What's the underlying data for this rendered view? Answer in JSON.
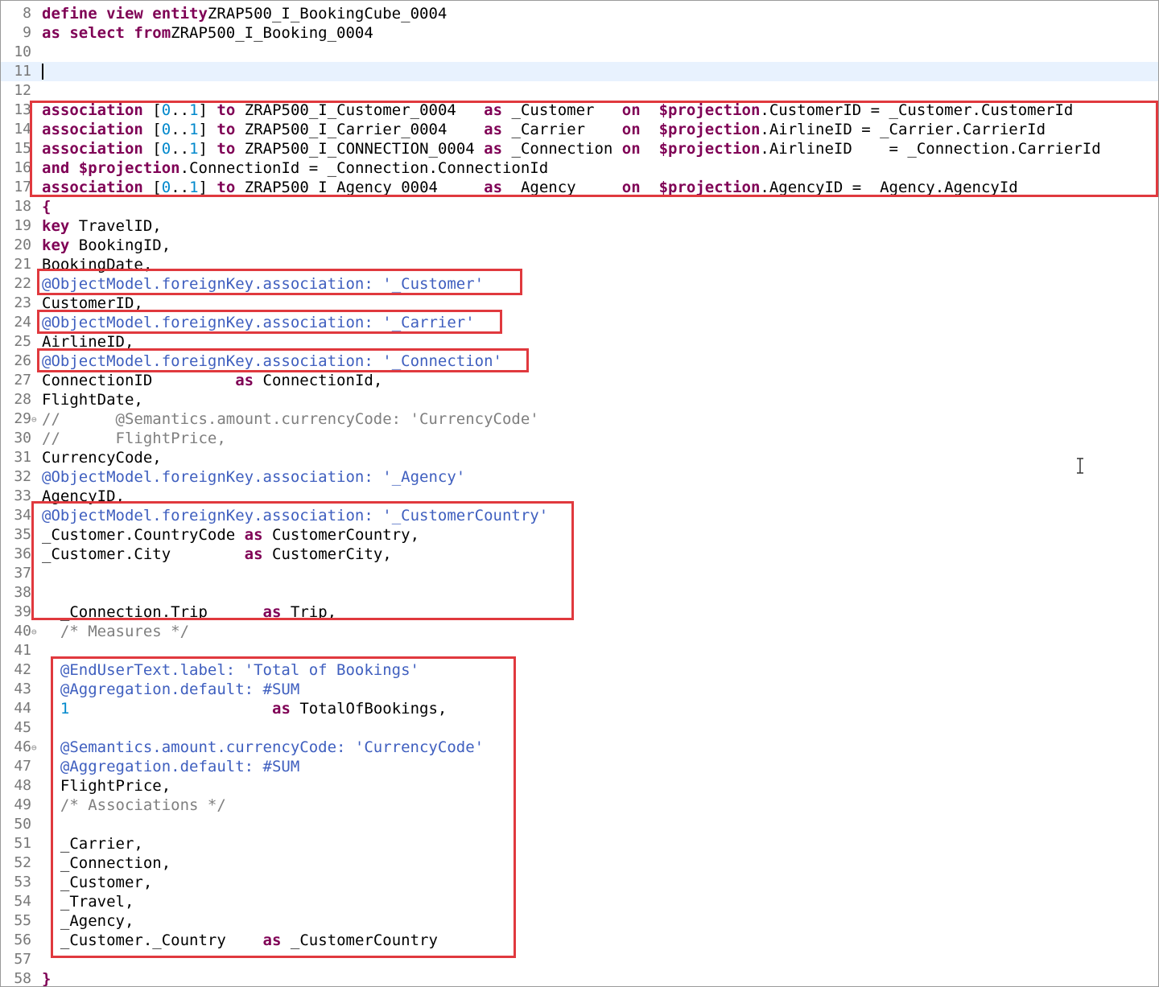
{
  "editor": {
    "current_line": "11",
    "lines": [
      {
        "n": "8",
        "fold": "",
        "segs": [
          [
            "kw",
            "define view entity"
          ],
          [
            "",
            "ZRAP500_I_BookingCube_0004"
          ]
        ]
      },
      {
        "n": "9",
        "fold": "",
        "segs": [
          [
            "kw",
            "as select from"
          ],
          [
            "",
            "ZRAP500_I_Booking_0004"
          ]
        ]
      },
      {
        "n": "10",
        "fold": "",
        "segs": []
      },
      {
        "n": "11",
        "fold": "",
        "segs": []
      },
      {
        "n": "12",
        "fold": "",
        "segs": []
      },
      {
        "n": "13",
        "fold": "",
        "segs": [
          [
            "kw",
            "association"
          ],
          [
            "",
            " ["
          ],
          [
            "nm",
            "0"
          ],
          [
            "",
            ".."
          ],
          [
            "nm",
            "1"
          ],
          [
            "",
            "] "
          ],
          [
            "kw",
            "to"
          ],
          [
            "",
            " ZRAP500_I_Customer_0004   "
          ],
          [
            "kw",
            "as"
          ],
          [
            "",
            " _Customer   "
          ],
          [
            "kw",
            "on"
          ],
          [
            "",
            "  "
          ],
          [
            "kw",
            "$projection"
          ],
          [
            "",
            ".CustomerID = _Customer.CustomerId"
          ]
        ]
      },
      {
        "n": "14",
        "fold": "",
        "segs": [
          [
            "kw",
            "association"
          ],
          [
            "",
            " ["
          ],
          [
            "nm",
            "0"
          ],
          [
            "",
            ".."
          ],
          [
            "nm",
            "1"
          ],
          [
            "",
            "] "
          ],
          [
            "kw",
            "to"
          ],
          [
            "",
            " ZRAP500_I_Carrier_0004    "
          ],
          [
            "kw",
            "as"
          ],
          [
            "",
            " _Carrier    "
          ],
          [
            "kw",
            "on"
          ],
          [
            "",
            "  "
          ],
          [
            "kw",
            "$projection"
          ],
          [
            "",
            ".AirlineID = _Carrier.CarrierId"
          ]
        ]
      },
      {
        "n": "15",
        "fold": "",
        "segs": [
          [
            "kw",
            "association"
          ],
          [
            "",
            " ["
          ],
          [
            "nm",
            "0"
          ],
          [
            "",
            ".."
          ],
          [
            "nm",
            "1"
          ],
          [
            "",
            "] "
          ],
          [
            "kw",
            "to"
          ],
          [
            "",
            " ZRAP500_I_CONNECTION_0004 "
          ],
          [
            "kw",
            "as"
          ],
          [
            "",
            " _Connection "
          ],
          [
            "kw",
            "on"
          ],
          [
            "",
            "  "
          ],
          [
            "kw",
            "$projection"
          ],
          [
            "",
            ".AirlineID    = _Connection.CarrierId"
          ]
        ]
      },
      {
        "n": "16",
        "fold": "",
        "segs": [
          [
            "kw",
            "and"
          ],
          [
            "",
            " "
          ],
          [
            "kw",
            "$projection"
          ],
          [
            "",
            ".ConnectionId = _Connection.ConnectionId"
          ]
        ]
      },
      {
        "n": "17",
        "fold": "",
        "segs": [
          [
            "kw",
            "association"
          ],
          [
            "",
            " ["
          ],
          [
            "nm",
            "0"
          ],
          [
            "",
            ".."
          ],
          [
            "nm",
            "1"
          ],
          [
            "",
            "] "
          ],
          [
            "kw",
            "to"
          ],
          [
            "",
            " ZRAP500_I_Agency_0004     "
          ],
          [
            "kw",
            "as"
          ],
          [
            "",
            " _Agency     "
          ],
          [
            "kw",
            "on"
          ],
          [
            "",
            "  "
          ],
          [
            "kw",
            "$projection"
          ],
          [
            "",
            ".AgencyID = _Agency.AgencyId"
          ]
        ]
      },
      {
        "n": "18",
        "fold": "",
        "segs": [
          [
            "kw",
            "{"
          ]
        ]
      },
      {
        "n": "19",
        "fold": "",
        "segs": [
          [
            "kw",
            "key"
          ],
          [
            "",
            " TravelID,"
          ]
        ]
      },
      {
        "n": "20",
        "fold": "",
        "segs": [
          [
            "kw",
            "key"
          ],
          [
            "",
            " BookingID,"
          ]
        ]
      },
      {
        "n": "21",
        "fold": "",
        "segs": [
          [
            "",
            "BookingDate,"
          ]
        ]
      },
      {
        "n": "22",
        "fold": "",
        "segs": [
          [
            "an",
            "@ObjectModel.foreignKey.association: "
          ],
          [
            "an",
            "'_Customer'"
          ]
        ]
      },
      {
        "n": "23",
        "fold": "",
        "segs": [
          [
            "",
            "CustomerID,"
          ]
        ]
      },
      {
        "n": "24",
        "fold": "",
        "segs": [
          [
            "an",
            "@ObjectModel.foreignKey.association: "
          ],
          [
            "an",
            "'_Carrier'"
          ]
        ]
      },
      {
        "n": "25",
        "fold": "",
        "segs": [
          [
            "",
            "AirlineID,"
          ]
        ]
      },
      {
        "n": "26",
        "fold": "",
        "segs": [
          [
            "an",
            "@ObjectModel.foreignKey.association: "
          ],
          [
            "an",
            "'_Connection'"
          ]
        ]
      },
      {
        "n": "27",
        "fold": "",
        "segs": [
          [
            "",
            "ConnectionID         "
          ],
          [
            "kw",
            "as"
          ],
          [
            "",
            " ConnectionId,"
          ]
        ]
      },
      {
        "n": "28",
        "fold": "",
        "segs": [
          [
            "",
            "FlightDate,"
          ]
        ]
      },
      {
        "n": "29",
        "fold": "⊖",
        "segs": [
          [
            "cm",
            "//      @Semantics.amount.currencyCode: 'CurrencyCode'"
          ]
        ]
      },
      {
        "n": "30",
        "fold": "",
        "segs": [
          [
            "cm",
            "//      FlightPrice,"
          ]
        ]
      },
      {
        "n": "31",
        "fold": "",
        "segs": [
          [
            "",
            "CurrencyCode,"
          ]
        ]
      },
      {
        "n": "32",
        "fold": "",
        "segs": [
          [
            "an",
            "@ObjectModel.foreignKey.association: "
          ],
          [
            "an",
            "'_Agency'"
          ]
        ]
      },
      {
        "n": "33",
        "fold": "",
        "segs": [
          [
            "",
            "AgencyID,"
          ]
        ]
      },
      {
        "n": "34",
        "fold": "",
        "segs": [
          [
            "an",
            "@ObjectModel.foreignKey.association: "
          ],
          [
            "an",
            "'_CustomerCountry'"
          ]
        ]
      },
      {
        "n": "35",
        "fold": "",
        "segs": [
          [
            "",
            "_Customer.CountryCode "
          ],
          [
            "kw",
            "as"
          ],
          [
            "",
            " CustomerCountry,"
          ]
        ]
      },
      {
        "n": "36",
        "fold": "",
        "segs": [
          [
            "",
            "_Customer.City        "
          ],
          [
            "kw",
            "as"
          ],
          [
            "",
            " CustomerCity,"
          ]
        ]
      },
      {
        "n": "37",
        "fold": "",
        "segs": []
      },
      {
        "n": "38",
        "fold": "",
        "segs": []
      },
      {
        "n": "39",
        "fold": "",
        "segs": [
          [
            "",
            "  _Connection.Trip      "
          ],
          [
            "kw",
            "as"
          ],
          [
            "",
            " Trip,"
          ]
        ]
      },
      {
        "n": "40",
        "fold": "⊖",
        "segs": [
          [
            "cm",
            "  /* Measures */"
          ]
        ]
      },
      {
        "n": "41",
        "fold": "",
        "segs": []
      },
      {
        "n": "42",
        "fold": "",
        "segs": [
          [
            "an",
            "  @EndUserText.label: 'Total of Bookings'"
          ]
        ]
      },
      {
        "n": "43",
        "fold": "",
        "segs": [
          [
            "an",
            "  @Aggregation.default: #SUM"
          ]
        ]
      },
      {
        "n": "44",
        "fold": "",
        "segs": [
          [
            "nm",
            "  1"
          ],
          [
            "",
            "                      "
          ],
          [
            "kw",
            "as"
          ],
          [
            "",
            " TotalOfBookings,"
          ]
        ]
      },
      {
        "n": "45",
        "fold": "",
        "segs": []
      },
      {
        "n": "46",
        "fold": "⊖",
        "segs": [
          [
            "an",
            "  @Semantics.amount.currencyCode: 'CurrencyCode'"
          ]
        ]
      },
      {
        "n": "47",
        "fold": "",
        "segs": [
          [
            "an",
            "  @Aggregation.default: #SUM"
          ]
        ]
      },
      {
        "n": "48",
        "fold": "",
        "segs": [
          [
            "",
            "  FlightPrice,"
          ]
        ]
      },
      {
        "n": "49",
        "fold": "",
        "segs": [
          [
            "cm",
            "  /* Associations */"
          ]
        ]
      },
      {
        "n": "50",
        "fold": "",
        "segs": []
      },
      {
        "n": "51",
        "fold": "",
        "segs": [
          [
            "",
            "  _Carrier,"
          ]
        ]
      },
      {
        "n": "52",
        "fold": "",
        "segs": [
          [
            "",
            "  _Connection,"
          ]
        ]
      },
      {
        "n": "53",
        "fold": "",
        "segs": [
          [
            "",
            "  _Customer,"
          ]
        ]
      },
      {
        "n": "54",
        "fold": "",
        "segs": [
          [
            "",
            "  _Travel,"
          ]
        ]
      },
      {
        "n": "55",
        "fold": "",
        "segs": [
          [
            "",
            "  _Agency,"
          ]
        ]
      },
      {
        "n": "56",
        "fold": "",
        "segs": [
          [
            "",
            "  _Customer._Country    "
          ],
          [
            "kw",
            "as"
          ],
          [
            "",
            " _CustomerCountry"
          ]
        ]
      },
      {
        "n": "57",
        "fold": "",
        "segs": []
      },
      {
        "n": "58",
        "fold": "",
        "segs": [
          [
            "kw",
            "}"
          ]
        ]
      }
    ]
  },
  "highlight_color": "#e0393e"
}
